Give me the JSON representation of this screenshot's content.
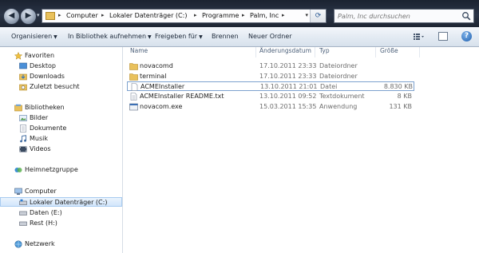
{
  "address": {
    "crumbs": [
      "Computer",
      "Lokaler Datenträger (C:)",
      "Programme",
      "Palm, Inc"
    ]
  },
  "search": {
    "placeholder": "Palm, Inc durchsuchen"
  },
  "toolbar": {
    "organize": "Organisieren",
    "include_library": "In Bibliothek aufnehmen",
    "share": "Freigeben für",
    "burn": "Brennen",
    "new_folder": "Neuer Ordner"
  },
  "nav": {
    "favorites": "Favoriten",
    "desktop": "Desktop",
    "downloads": "Downloads",
    "recent": "Zuletzt besucht",
    "libraries": "Bibliotheken",
    "pictures": "Bilder",
    "documents": "Dokumente",
    "music": "Musik",
    "videos": "Videos",
    "homegroup": "Heimnetzgruppe",
    "computer": "Computer",
    "drive_c": "Lokaler Datenträger (C:)",
    "drive_e": "Daten (E:)",
    "drive_h": "Rest (H:)",
    "network": "Netzwerk"
  },
  "columns": {
    "name": "Name",
    "modified": "Änderungsdatum",
    "type": "Typ",
    "size": "Größe"
  },
  "files": [
    {
      "name": "novacomd",
      "modified": "17.10.2011 23:33",
      "type": "Dateiordner",
      "size": "",
      "icon": "folder-icon"
    },
    {
      "name": "terminal",
      "modified": "17.10.2011 23:33",
      "type": "Dateiordner",
      "size": "",
      "icon": "folder-icon"
    },
    {
      "name": "ACMEInstaller",
      "modified": "13.10.2011 21:01",
      "type": "Datei",
      "size": "8.830 KB",
      "icon": "file-icon"
    },
    {
      "name": "ACMEInstaller README.txt",
      "modified": "13.10.2011 09:52",
      "type": "Textdokument",
      "size": "8 KB",
      "icon": "text-file-icon"
    },
    {
      "name": "novacom.exe",
      "modified": "15.03.2011 15:35",
      "type": "Anwendung",
      "size": "131 KB",
      "icon": "exe-icon"
    }
  ]
}
